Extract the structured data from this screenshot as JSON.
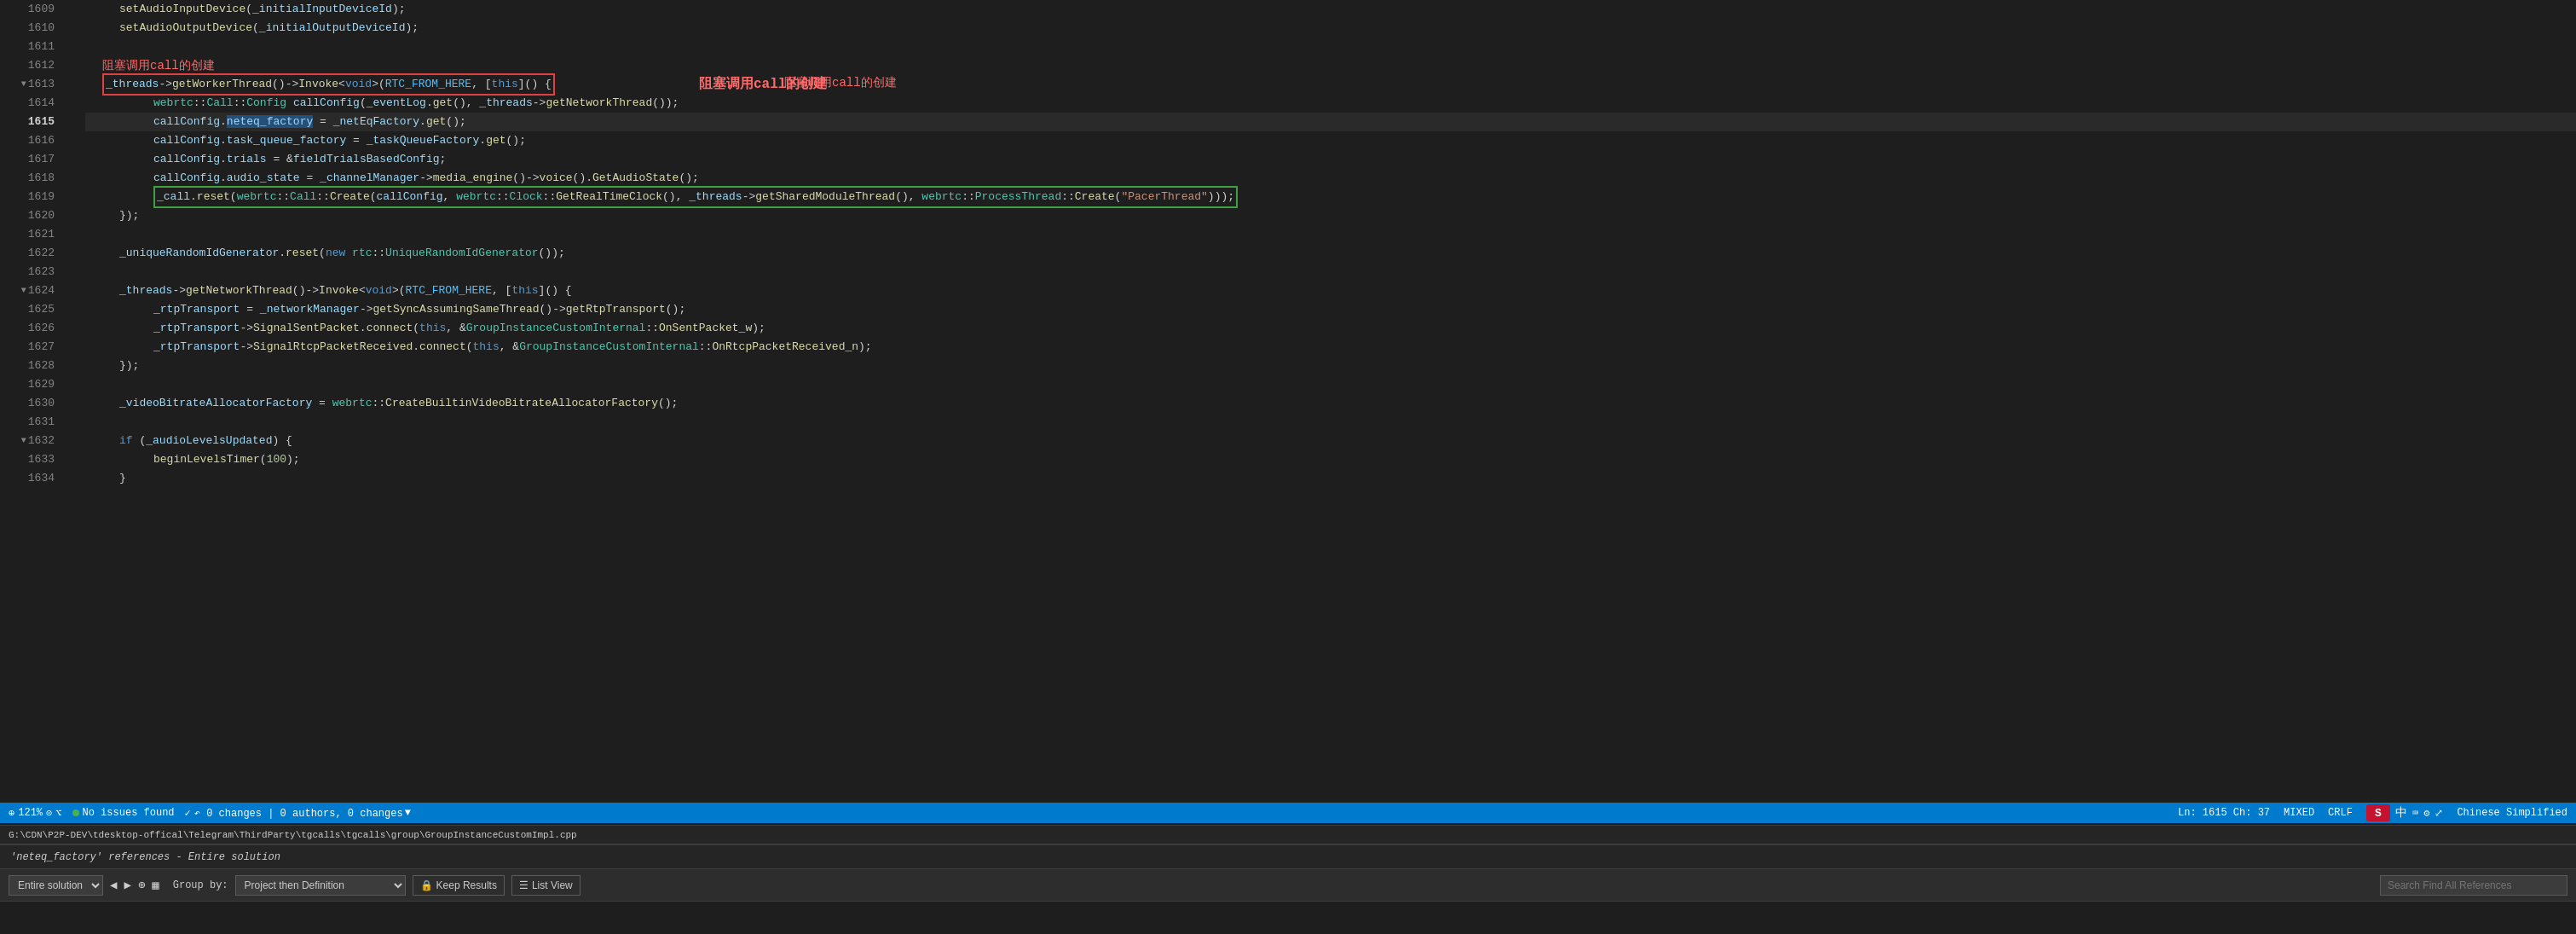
{
  "editor": {
    "title": "GroupInstanceCustomImpl.cpp",
    "zoom": "121%",
    "ln": "Ln: 1615",
    "ch": "Ch: 37",
    "encoding": "MIXED",
    "line_ending": "CRLF",
    "language": "Chinese Simplified",
    "file_path": "G:\\CDN\\P2P-DEV\\tdesktop-offical\\Telegram\\ThirdParty\\tgcalls\\tgcalls\\group\\GroupInstanceCustomImpl.cpp",
    "no_issues": "No issues found",
    "changes_info": "↶ 0 changes | 0 authors, 0 changes"
  },
  "status_bar": {
    "zoom_label": "121%",
    "issues_label": "No issues found",
    "changes_label": "↶ 0 changes | 0 authors, 0 changes",
    "ln_ch": "Ln: 1615  Ch: 37",
    "mixed": "MIXED",
    "crlf": "CRLF",
    "language": "Chinese Simplified"
  },
  "code_lines": [
    {
      "num": "1609",
      "content": "setAudioInputDevice(_initialInputDeviceId);",
      "indent": 2
    },
    {
      "num": "1610",
      "content": "setAudioOutputDevice(_initialOutputDeviceId);",
      "indent": 2
    },
    {
      "num": "1611",
      "content": "",
      "indent": 0
    },
    {
      "num": "1612",
      "content": "",
      "indent": 0
    },
    {
      "num": "1613",
      "content": "_threads->getWorkerThread()->Invoke<void>(RTC_FROM_HERE, [this]() {",
      "indent": 1,
      "has_fold": true,
      "highlight": "red"
    },
    {
      "num": "1614",
      "content": "webrtc::Call::Config callConfig(_eventLog.get(), _threads->getNetworkThread());",
      "indent": 3
    },
    {
      "num": "1615",
      "content": "callConfig.neteq_factory = _netEqFactory.get();",
      "indent": 3,
      "active": true
    },
    {
      "num": "1616",
      "content": "callConfig.task_queue_factory = _taskQueueFactory.get();",
      "indent": 3
    },
    {
      "num": "1617",
      "content": "callConfig.trials = &fieldTrialsBasedConfig;",
      "indent": 3
    },
    {
      "num": "1618",
      "content": "callConfig.audio_state = _channelManager->media_engine()->voice().GetAudioState();",
      "indent": 3
    },
    {
      "num": "1619",
      "content": "_call.reset(webrtc::Call::Create(callConfig, webrtc::Clock::GetRealTimeClock(), _threads->getSharedModuleThread(), webrtc::ProcessThread::Create(\"PacerThread\")));",
      "indent": 3,
      "highlight": "green"
    },
    {
      "num": "1620",
      "content": "});",
      "indent": 1
    },
    {
      "num": "1621",
      "content": "",
      "indent": 0
    },
    {
      "num": "1622",
      "content": "_uniqueRandomIdGenerator.reset(new rtc::UniqueRandomIdGenerator());",
      "indent": 1
    },
    {
      "num": "1623",
      "content": "",
      "indent": 0
    },
    {
      "num": "1624",
      "content": "_threads->getNetworkThread()->Invoke<void>(RTC_FROM_HERE, [this]() {",
      "indent": 1,
      "has_fold": true
    },
    {
      "num": "1625",
      "content": "_rtpTransport = _networkManager->getSyncAssumingSameThread()->getRtpTransport();",
      "indent": 3
    },
    {
      "num": "1626",
      "content": "_rtpTransport->SignalSentPacket.connect(this, &GroupInstanceCustomInternal::OnSentPacket_w);",
      "indent": 3
    },
    {
      "num": "1627",
      "content": "_rtpTransport->SignalRtcpPacketReceived.connect(this, &GroupInstanceCustomInternal::OnRtcpPacketReceived_n);",
      "indent": 3
    },
    {
      "num": "1628",
      "content": "});",
      "indent": 1
    },
    {
      "num": "1629",
      "content": "",
      "indent": 0
    },
    {
      "num": "1630",
      "content": "_videoBitrateAllocatorFactory = webrtc::CreateBuiltinVideoBitrateAllocatorFactory();",
      "indent": 1
    },
    {
      "num": "1631",
      "content": "",
      "indent": 0
    },
    {
      "num": "1632",
      "content": "if (_audioLevelsUpdated) {",
      "indent": 1,
      "has_fold": true
    },
    {
      "num": "1633",
      "content": "beginLevelsTimer(100);",
      "indent": 3
    },
    {
      "num": "1634",
      "content": "}",
      "indent": 1
    }
  ],
  "chinese_annotation": "阻塞调用call的创建",
  "bottom_panel": {
    "title": "'neteq_factory' references - Entire solution",
    "scope_label": "Entire solution",
    "group_by_label": "Group by:",
    "group_by_value": "Project then Definition",
    "keep_results_label": "Keep Results",
    "list_view_label": "List View",
    "search_label": "Search Find All References"
  }
}
